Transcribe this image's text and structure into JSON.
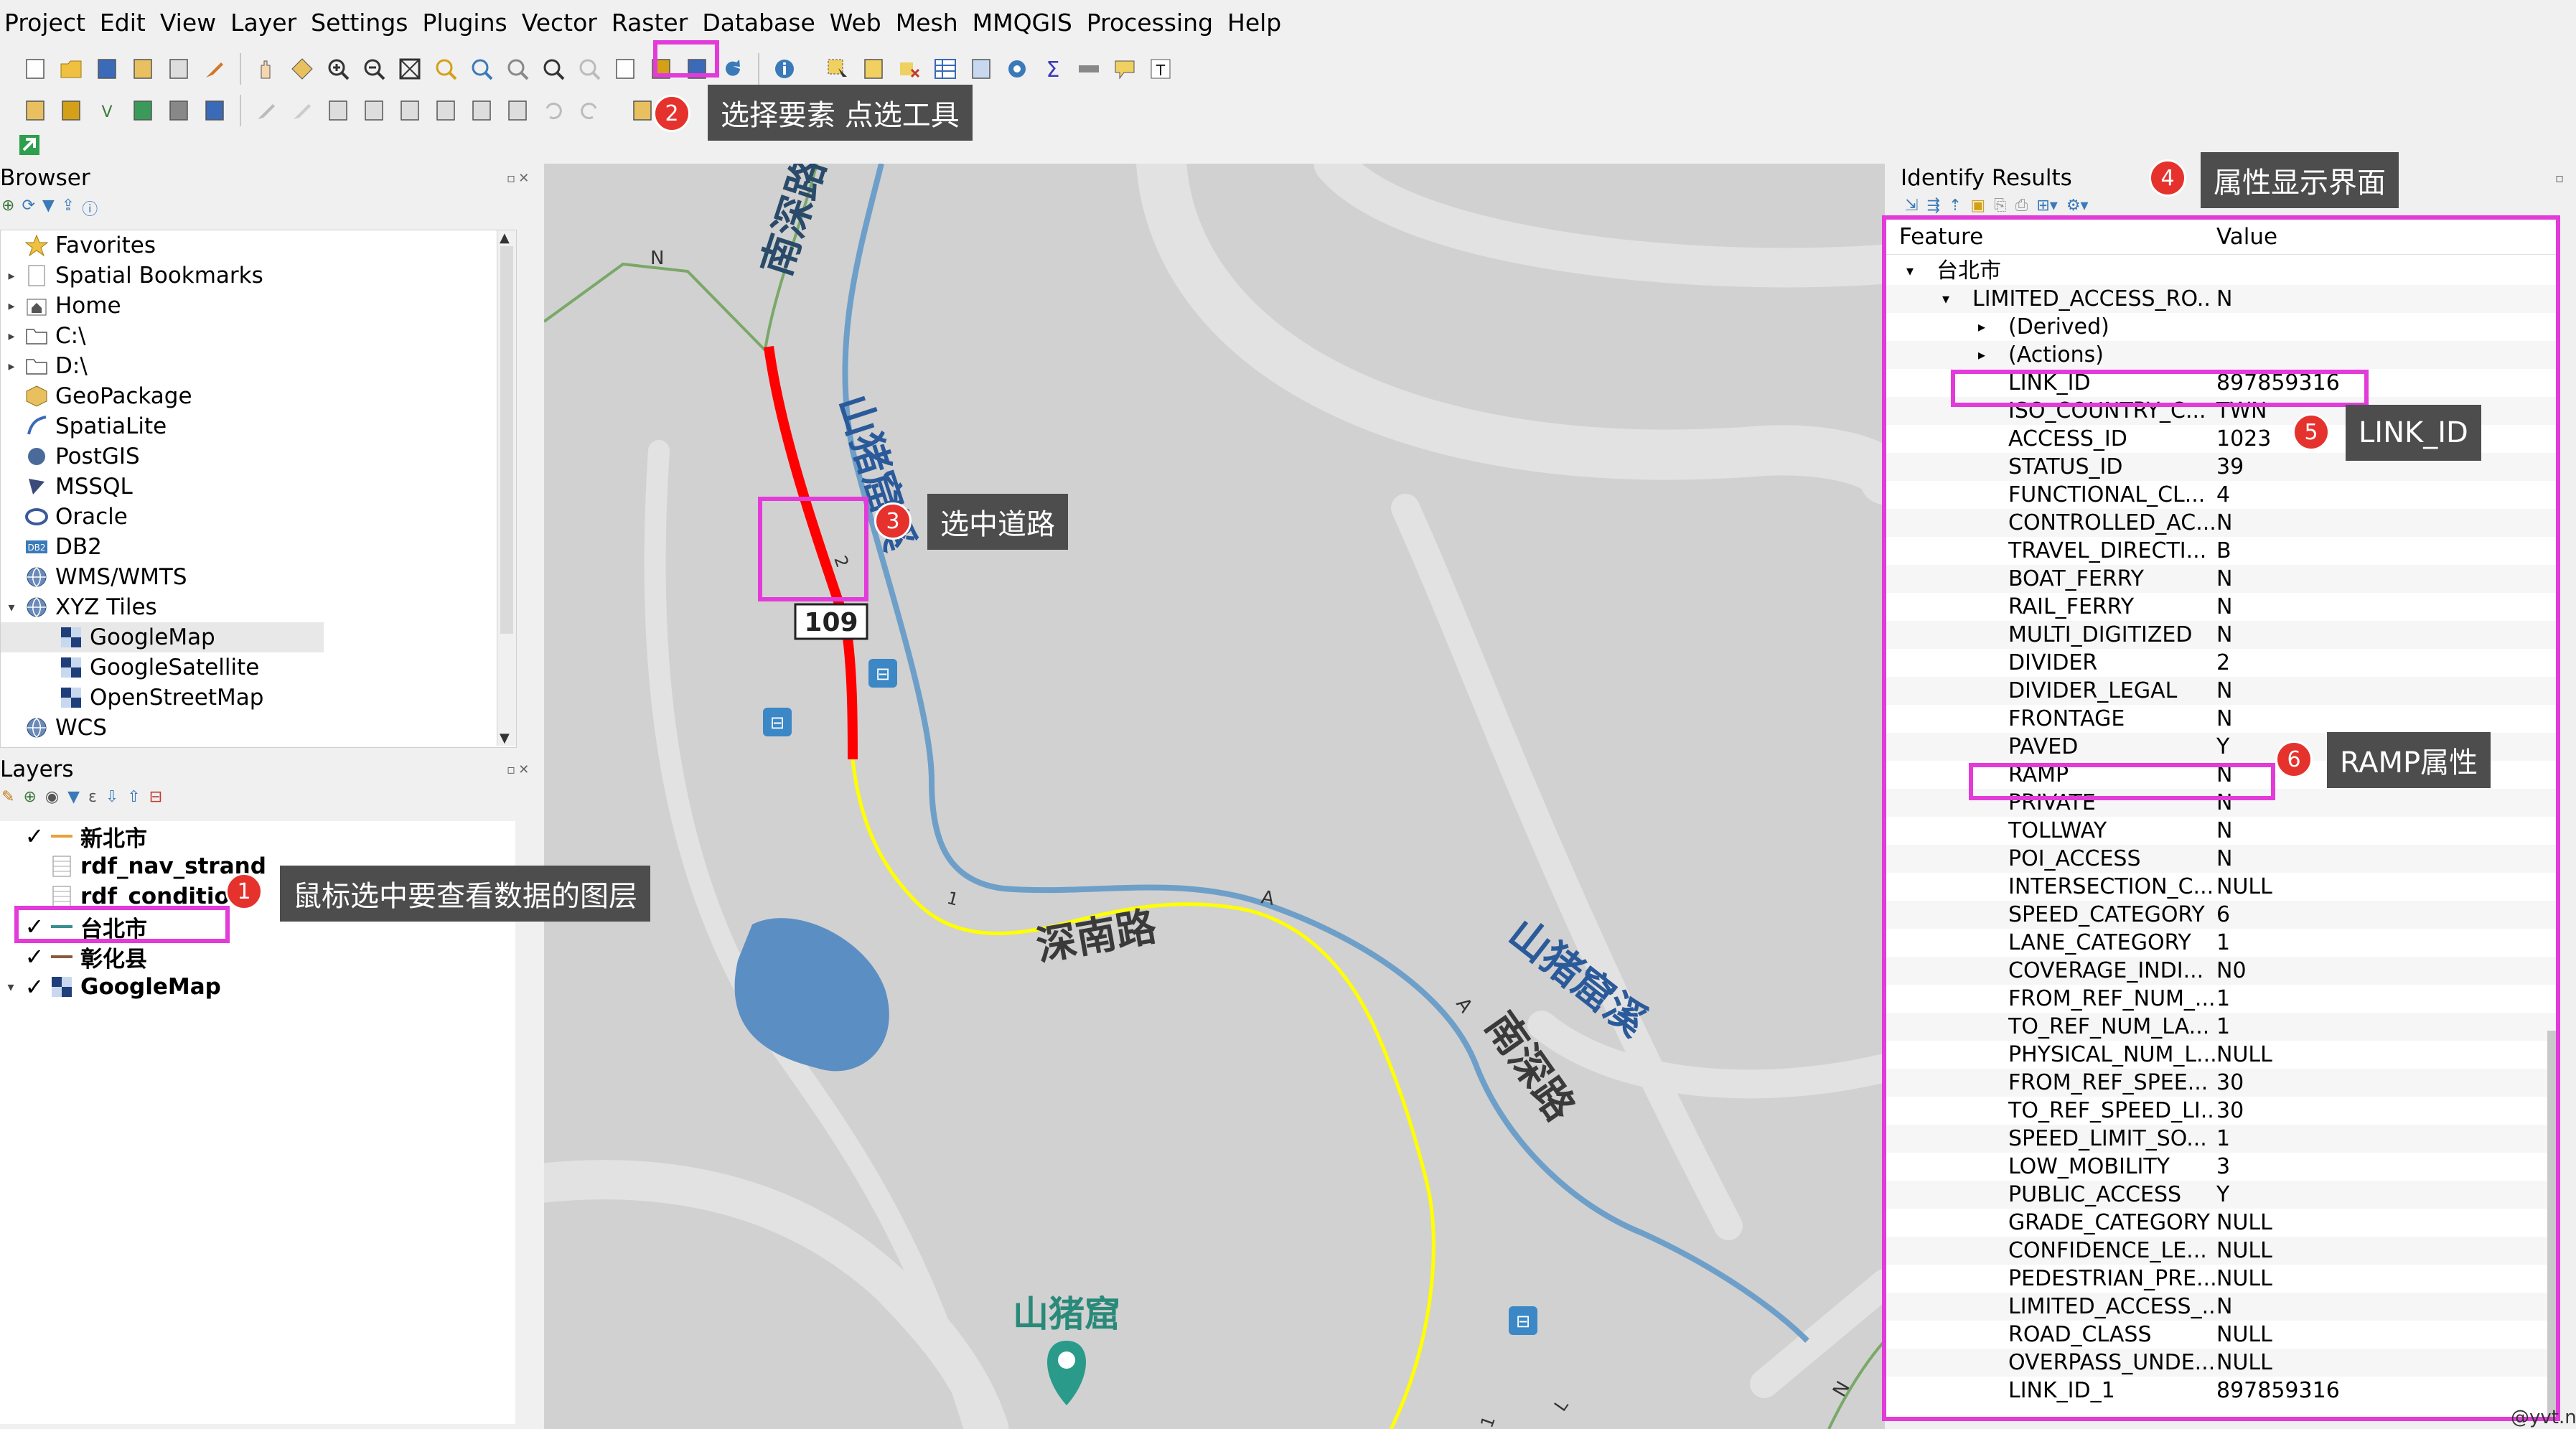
{
  "menu": [
    "Project",
    "Edit",
    "View",
    "Layer",
    "Settings",
    "Plugins",
    "Vector",
    "Raster",
    "Database",
    "Web",
    "Mesh",
    "MMQGIS",
    "Processing",
    "Help"
  ],
  "browser": {
    "title": "Browser",
    "items": [
      {
        "label": "Favorites",
        "icon": "star-icon",
        "expand": "",
        "indent": 0
      },
      {
        "label": "Spatial Bookmarks",
        "icon": "bookmark-icon",
        "expand": "▸",
        "indent": 0
      },
      {
        "label": "Home",
        "icon": "home-folder-icon",
        "expand": "▸",
        "indent": 0
      },
      {
        "label": "C:\\",
        "icon": "folder-icon",
        "expand": "▸",
        "indent": 0
      },
      {
        "label": "D:\\",
        "icon": "folder-icon",
        "expand": "▸",
        "indent": 0
      },
      {
        "label": "GeoPackage",
        "icon": "geopackage-icon",
        "expand": "",
        "indent": 0
      },
      {
        "label": "SpatiaLite",
        "icon": "spatialite-icon",
        "expand": "",
        "indent": 0
      },
      {
        "label": "PostGIS",
        "icon": "postgis-icon",
        "expand": "",
        "indent": 0
      },
      {
        "label": "MSSQL",
        "icon": "mssql-icon",
        "expand": "",
        "indent": 0
      },
      {
        "label": "Oracle",
        "icon": "oracle-icon",
        "expand": "",
        "indent": 0
      },
      {
        "label": "DB2",
        "icon": "db2-icon",
        "expand": "",
        "indent": 0
      },
      {
        "label": "WMS/WMTS",
        "icon": "globe-icon",
        "expand": "",
        "indent": 0
      },
      {
        "label": "XYZ Tiles",
        "icon": "globe-icon",
        "expand": "▾",
        "indent": 0
      },
      {
        "label": "GoogleMap",
        "icon": "xyz-tile-icon",
        "expand": "",
        "indent": 1,
        "selected": true
      },
      {
        "label": "GoogleSatellite",
        "icon": "xyz-tile-icon",
        "expand": "",
        "indent": 1
      },
      {
        "label": "OpenStreetMap",
        "icon": "xyz-tile-icon",
        "expand": "",
        "indent": 1
      },
      {
        "label": "WCS",
        "icon": "globe-icon",
        "expand": "",
        "indent": 0
      }
    ]
  },
  "layers": {
    "title": "Layers",
    "items": [
      {
        "label": "新北市",
        "checked": true,
        "icon": "line-layer-orange-icon",
        "color": "#e8a13a"
      },
      {
        "label": "rdf_nav_strand",
        "checked": false,
        "icon": "table-layer-icon",
        "color": "#888888"
      },
      {
        "label": "rdf_condition",
        "checked": false,
        "icon": "table-layer-icon",
        "color": "#888888"
      },
      {
        "label": "台北市",
        "checked": true,
        "icon": "line-layer-teal-icon",
        "color": "#3a8f8f"
      },
      {
        "label": "彰化县",
        "checked": true,
        "icon": "line-layer-brown-icon",
        "color": "#8a5a3a"
      },
      {
        "label": "GoogleMap",
        "checked": true,
        "icon": "xyz-tile-icon",
        "color": "#1e3f7a",
        "expand": "▾"
      }
    ]
  },
  "identify": {
    "title": "Identify Results",
    "header_feature": "Feature",
    "header_value": "Value",
    "layer_name": "台北市",
    "feature_name": "LIMITED_ACCESS_RO...",
    "feature_value": "N",
    "derived": "(Derived)",
    "actions": "(Actions)",
    "attributes": [
      {
        "name": "LINK_ID",
        "value": "897859316"
      },
      {
        "name": "ISO_COUNTRY_C...",
        "value": "TWN"
      },
      {
        "name": "ACCESS_ID",
        "value": "1023"
      },
      {
        "name": "STATUS_ID",
        "value": "39"
      },
      {
        "name": "FUNCTIONAL_CL...",
        "value": "4"
      },
      {
        "name": "CONTROLLED_AC...",
        "value": "N"
      },
      {
        "name": "TRAVEL_DIRECTI...",
        "value": "B"
      },
      {
        "name": "BOAT_FERRY",
        "value": "N"
      },
      {
        "name": "RAIL_FERRY",
        "value": "N"
      },
      {
        "name": "MULTI_DIGITIZED",
        "value": "N"
      },
      {
        "name": "DIVIDER",
        "value": "2"
      },
      {
        "name": "DIVIDER_LEGAL",
        "value": "N"
      },
      {
        "name": "FRONTAGE",
        "value": "N"
      },
      {
        "name": "PAVED",
        "value": "Y"
      },
      {
        "name": "RAMP",
        "value": "N"
      },
      {
        "name": "PRIVATE",
        "value": "N"
      },
      {
        "name": "TOLLWAY",
        "value": "N"
      },
      {
        "name": "POI_ACCESS",
        "value": "N"
      },
      {
        "name": "INTERSECTION_C...",
        "value": "NULL"
      },
      {
        "name": "SPEED_CATEGORY",
        "value": "6"
      },
      {
        "name": "LANE_CATEGORY",
        "value": "1"
      },
      {
        "name": "COVERAGE_INDI...",
        "value": "N0"
      },
      {
        "name": "FROM_REF_NUM_...",
        "value": "1"
      },
      {
        "name": "TO_REF_NUM_LA...",
        "value": "1"
      },
      {
        "name": "PHYSICAL_NUM_L...",
        "value": "NULL"
      },
      {
        "name": "FROM_REF_SPEE...",
        "value": "30"
      },
      {
        "name": "TO_REF_SPEED_LI...",
        "value": "30"
      },
      {
        "name": "SPEED_LIMIT_SO...",
        "value": "1"
      },
      {
        "name": "LOW_MOBILITY",
        "value": "3"
      },
      {
        "name": "PUBLIC_ACCESS",
        "value": "Y"
      },
      {
        "name": "GRADE_CATEGORY",
        "value": "NULL"
      },
      {
        "name": "CONFIDENCE_LE...",
        "value": "NULL"
      },
      {
        "name": "PEDESTRIAN_PRE...",
        "value": "NULL"
      },
      {
        "name": "LIMITED_ACCESS_...",
        "value": "N"
      },
      {
        "name": "ROAD_CLASS",
        "value": "NULL"
      },
      {
        "name": "OVERPASS_UNDE...",
        "value": "NULL"
      },
      {
        "name": "LINK_ID_1",
        "value": "897859316"
      }
    ]
  },
  "map": {
    "labels": {
      "road_nanshen_top": "南深路",
      "stream_top": "山猪窟溪",
      "road_shennan": "深南路",
      "stream_right": "山猪窟溪",
      "road_nanshen_right": "南深路",
      "place": "山猪窟",
      "route_shield": "109",
      "n1": "N",
      "n2": "N",
      "a1": "A",
      "a2": "A",
      "one1": "1",
      "two1": "2",
      "l1": "L",
      "one2": "1"
    },
    "colors": {
      "selected_road": "#ff0000",
      "layer_road": "#ffff00",
      "water": "#5b9bd5",
      "green_road": "#6aa84f",
      "background": "#d1d1d1"
    }
  },
  "callouts": [
    {
      "num": "1",
      "text": "鼠标选中要查看数据的图层"
    },
    {
      "num": "2",
      "text": "选择要素 点选工具"
    },
    {
      "num": "3",
      "text": "选中道路"
    },
    {
      "num": "4",
      "text": "属性显示界面"
    },
    {
      "num": "5",
      "text": "LINK_ID"
    },
    {
      "num": "6",
      "text": "RAMP属性"
    }
  ],
  "watermark": "@yvt.n"
}
